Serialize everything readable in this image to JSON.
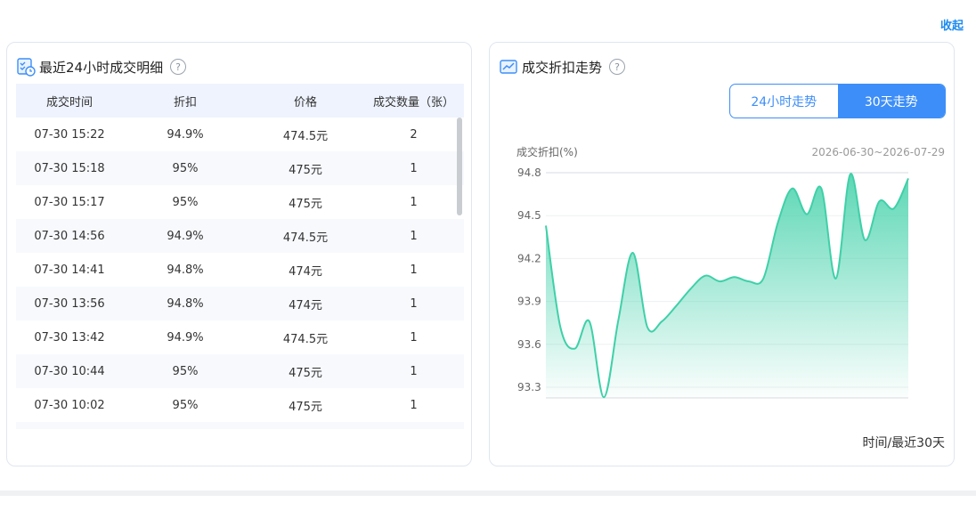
{
  "collapse_label": "收起",
  "left_card": {
    "title": "最近24小时成交明细",
    "help": "?",
    "columns": [
      "成交时间",
      "折扣",
      "价格",
      "成交数量（张）"
    ],
    "rows": [
      [
        "07-30 15:22",
        "94.9%",
        "474.5元",
        "2"
      ],
      [
        "07-30 15:18",
        "95%",
        "475元",
        "1"
      ],
      [
        "07-30 15:17",
        "95%",
        "475元",
        "1"
      ],
      [
        "07-30 14:56",
        "94.9%",
        "474.5元",
        "1"
      ],
      [
        "07-30 14:41",
        "94.8%",
        "474元",
        "1"
      ],
      [
        "07-30 13:56",
        "94.8%",
        "474元",
        "1"
      ],
      [
        "07-30 13:42",
        "94.9%",
        "474.5元",
        "1"
      ],
      [
        "07-30 10:44",
        "95%",
        "475元",
        "1"
      ],
      [
        "07-30 10:02",
        "95%",
        "475元",
        "1"
      ]
    ]
  },
  "right_card": {
    "title": "成交折扣走势",
    "help": "?",
    "tabs": [
      "24小时走势",
      "30天走势"
    ],
    "active_tab": 1,
    "x_caption": "时间/最近30天"
  },
  "chart_data": {
    "type": "area",
    "ylabel": "成交折扣(%)",
    "date_range": "2026-06-30~2026-07-29",
    "yticks": [
      "94.8",
      "94.5",
      "94.2",
      "93.9",
      "93.6",
      "93.3"
    ],
    "ylim": [
      93.3,
      94.8
    ],
    "line_color": "#3fd0a8",
    "values": [
      94.43,
      93.72,
      93.57,
      93.76,
      93.23,
      93.77,
      94.24,
      93.72,
      93.76,
      93.87,
      93.99,
      94.08,
      94.04,
      94.07,
      94.04,
      94.06,
      94.45,
      94.69,
      94.51,
      94.69,
      94.06,
      94.79,
      94.33,
      94.6,
      94.55,
      94.76
    ]
  },
  "colors": {
    "accent": "#3d8ef8",
    "link": "#1d8bf0",
    "header_bg": "#eef3fe"
  }
}
